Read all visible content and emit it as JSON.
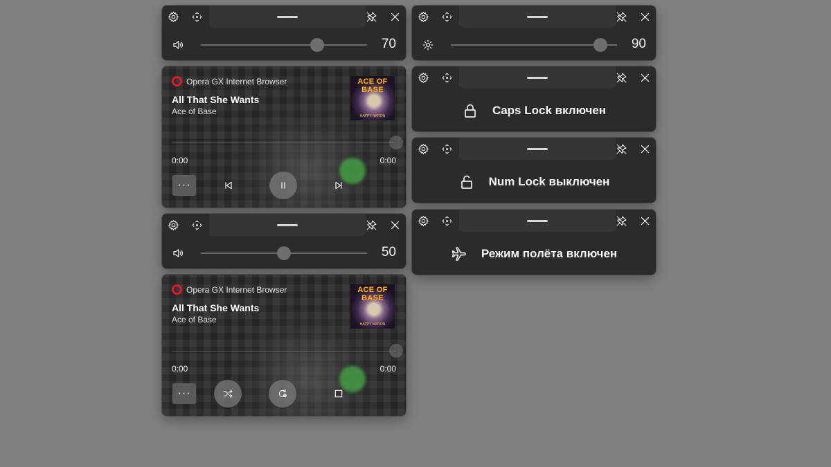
{
  "volume_flyout_1": {
    "value_text": "70",
    "level_percent": 70,
    "icon": "speaker-icon"
  },
  "brightness_flyout": {
    "value_text": "90",
    "level_percent": 90,
    "icon": "sun-icon"
  },
  "volume_flyout_2": {
    "value_text": "50",
    "level_percent": 50,
    "icon": "speaker-icon"
  },
  "caps_lock_flyout": {
    "text": "Caps Lock включен",
    "icon": "lock-closed-icon"
  },
  "num_lock_flyout": {
    "text": "Num Lock выключен",
    "icon": "lock-open-icon"
  },
  "airplane_flyout": {
    "text": "Режим полёта включен",
    "icon": "airplane-icon"
  },
  "media_flyout_1": {
    "source": "Opera GX Internet Browser",
    "title": "All That She Wants",
    "artist": "Ace of Base",
    "time_elapsed": "0:00",
    "time_total": "0:00",
    "album_art_title": "ACE OF BASE",
    "album_art_subtitle": "HAPPY NATION",
    "more_label": "···"
  },
  "media_flyout_2": {
    "source": "Opera GX Internet Browser",
    "title": "All That She Wants",
    "artist": "Ace of Base",
    "time_elapsed": "0:00",
    "time_total": "0:00",
    "album_art_title": "ACE OF BASE",
    "album_art_subtitle": "HAPPY NATION",
    "more_label": "···"
  },
  "colors": {
    "background": "#808080",
    "flyout_bg": "#2b2b2b",
    "opera_red": "#e21a2e",
    "album_title": "#f7b21b"
  }
}
